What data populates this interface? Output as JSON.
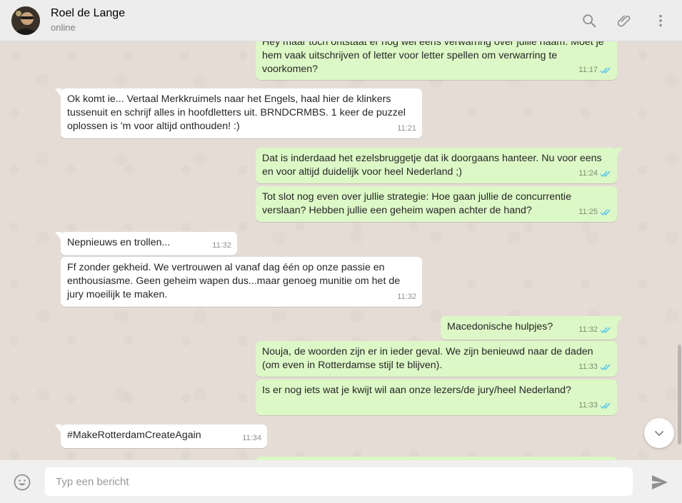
{
  "header": {
    "contact_name": "Roel de Lange",
    "status": "online"
  },
  "messages": [
    {
      "direction": "out",
      "text": "Hey maar toch ontstaat er nog wel eens verwarring over jullie naam. Moet je hem vaak uitschrijven of letter voor letter spellen om verwarring te voorkomen?",
      "time": "11:17",
      "read": true
    },
    {
      "direction": "in",
      "text": "Ok komt ie... Vertaal Merkkruimels naar het Engels, haal hier de klinkers tussenuit en schrijf alles in hoofdletters uit. BRNDCRMBS. 1 keer de puzzel oplossen is 'm voor altijd onthouden! :)",
      "time": "11:21"
    },
    {
      "direction": "out",
      "text": "Dat is inderdaad het ezelsbruggetje dat ik doorgaans hanteer. Nu voor eens en voor altijd duidelijk voor heel Nederland ;)",
      "time": "11:24",
      "read": true
    },
    {
      "direction": "out",
      "text": "Tot slot nog even over jullie strategie: Hoe gaan jullie de concurrentie verslaan? Hebben jullie een geheim wapen achter de hand?",
      "time": "11:25",
      "read": true
    },
    {
      "direction": "in",
      "text": "Nepnieuws en trollen...",
      "time": "11:32"
    },
    {
      "direction": "in",
      "text": "Ff zonder gekheid. We vertrouwen al vanaf dag één op onze passie en enthousiasme. Geen geheim wapen dus...maar genoeg munitie om het de jury moeilijk te maken.",
      "time": "11:32"
    },
    {
      "direction": "out",
      "text": "Macedonische hulpjes?",
      "time": "11:32",
      "read": true
    },
    {
      "direction": "out",
      "text": "Nouja, de woorden zijn er in ieder geval. We zijn benieuwd naar de daden (om even in Rotterdamse stijl te blijven).",
      "time": "11:33",
      "read": true
    },
    {
      "direction": "out",
      "text": "Is er nog iets wat je kwijt wil aan onze lezers/de jury/heel Nederland?",
      "time": "11:33",
      "read": true
    },
    {
      "direction": "in",
      "text": "#MakeRotterdamCreateAgain",
      "time": "11:34"
    }
  ],
  "composer": {
    "placeholder": "Typ een bericht"
  },
  "icons": {
    "search": "search-icon",
    "attach": "paperclip-icon",
    "menu": "more-vertical-icon",
    "emoji": "emoji-icon",
    "send": "send-icon",
    "scroll_down": "chevron-down-icon"
  },
  "colors": {
    "outgoing_bubble": "#dcf8c6",
    "incoming_bubble": "#ffffff",
    "chat_background": "#e5ddd5",
    "read_ticks": "#4fc3f7"
  }
}
